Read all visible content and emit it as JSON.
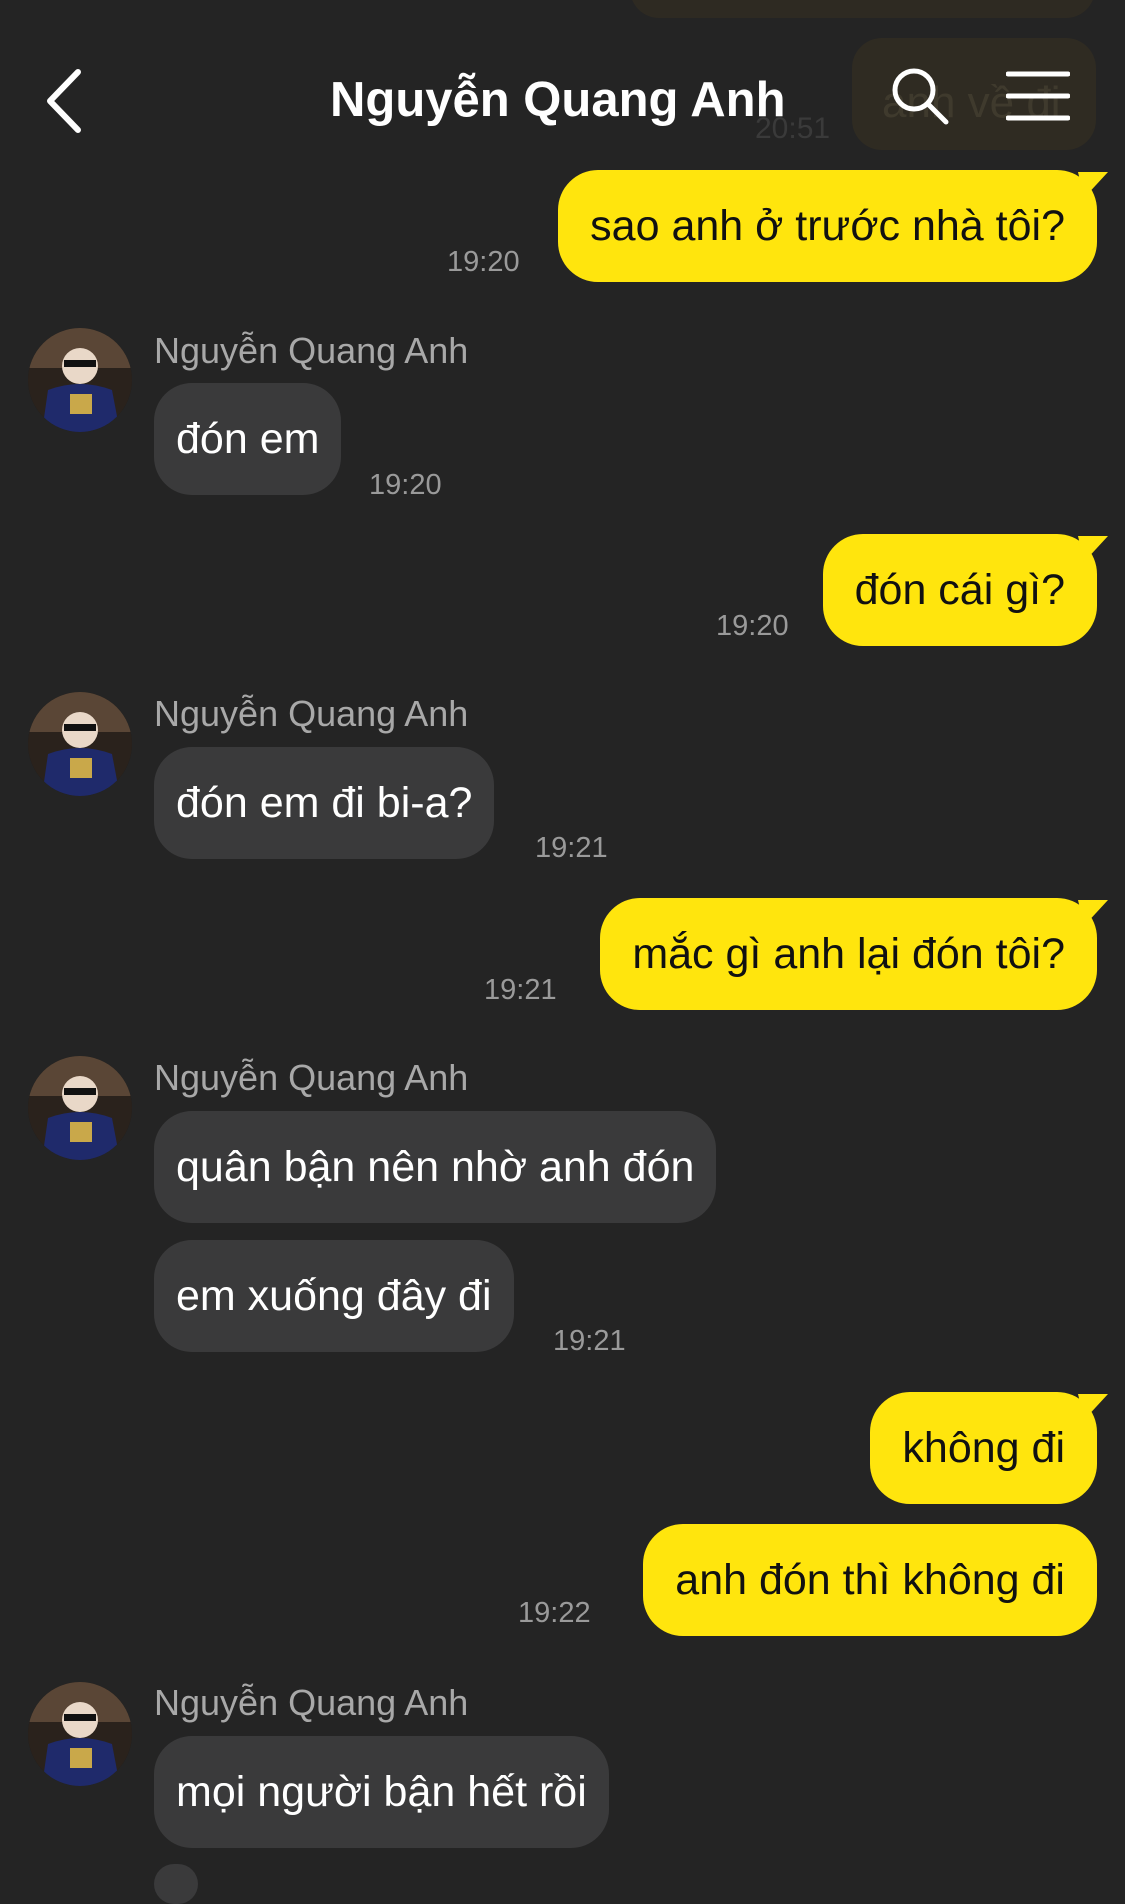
{
  "header": {
    "title": "Nguyễn Quang Anh",
    "back_icon": "chevron-left-icon",
    "search_icon": "search-icon",
    "menu_icon": "menu-icon",
    "ghost_text": "anh về đi",
    "ghost_time": "20:51"
  },
  "colors": {
    "background": "#242424",
    "outgoing_bubble": "#ffe50d",
    "incoming_bubble": "#3a3a3b"
  },
  "messages": [
    {
      "dir": "out",
      "text": "sao anh ở trước nhà tôi?",
      "time": "19:20"
    },
    {
      "dir": "in",
      "sender": "Nguyễn Quang Anh",
      "text": "đón em",
      "time": "19:20"
    },
    {
      "dir": "out",
      "text": "đón cái gì?",
      "time": "19:20"
    },
    {
      "dir": "in",
      "sender": "Nguyễn Quang Anh",
      "text": "đón em đi bi-a?",
      "time": "19:21"
    },
    {
      "dir": "out",
      "text": "mắc gì anh lại đón tôi?",
      "time": "19:21"
    },
    {
      "dir": "in",
      "sender": "Nguyễn Quang Anh",
      "text": "quân bận nên nhờ anh đón"
    },
    {
      "dir": "in",
      "text": "em xuống đây đi",
      "time": "19:21"
    },
    {
      "dir": "out",
      "text": "không đi"
    },
    {
      "dir": "out",
      "text": "anh đón thì không đi",
      "time": "19:22"
    },
    {
      "dir": "in",
      "sender": "Nguyễn Quang Anh",
      "text": "mọi người bận hết rồi"
    }
  ]
}
